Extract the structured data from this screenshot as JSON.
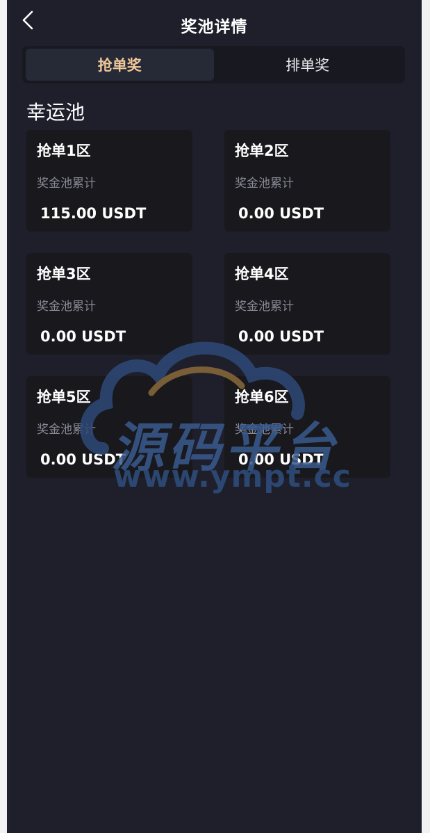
{
  "header": {
    "title": "奖池详情",
    "back_icon": "chevron-left-icon"
  },
  "tabs": [
    {
      "label": "抢单奖",
      "active": true
    },
    {
      "label": "排单奖",
      "active": false
    }
  ],
  "section": {
    "title": "幸运池"
  },
  "cards": [
    {
      "title": "抢单1区",
      "label": "奖金池累计",
      "value": "115.00 USDT"
    },
    {
      "title": "抢单2区",
      "label": "奖金池累计",
      "value": "0.00 USDT"
    },
    {
      "title": "抢单3区",
      "label": "奖金池累计",
      "value": "0.00 USDT"
    },
    {
      "title": "抢单4区",
      "label": "奖金池累计",
      "value": "0.00 USDT"
    },
    {
      "title": "抢单5区",
      "label": "奖金池累计",
      "value": "0.00 USDT"
    },
    {
      "title": "抢单6区",
      "label": "奖金池累计",
      "value": "0.00 USDT"
    }
  ],
  "watermark": {
    "text": "源码平台",
    "url": "www.ympt.cc"
  },
  "colors": {
    "background": "#1f1f2b",
    "card": "#18181d",
    "active_tab_text": "#f0c79a",
    "label": "#8a8a96"
  }
}
